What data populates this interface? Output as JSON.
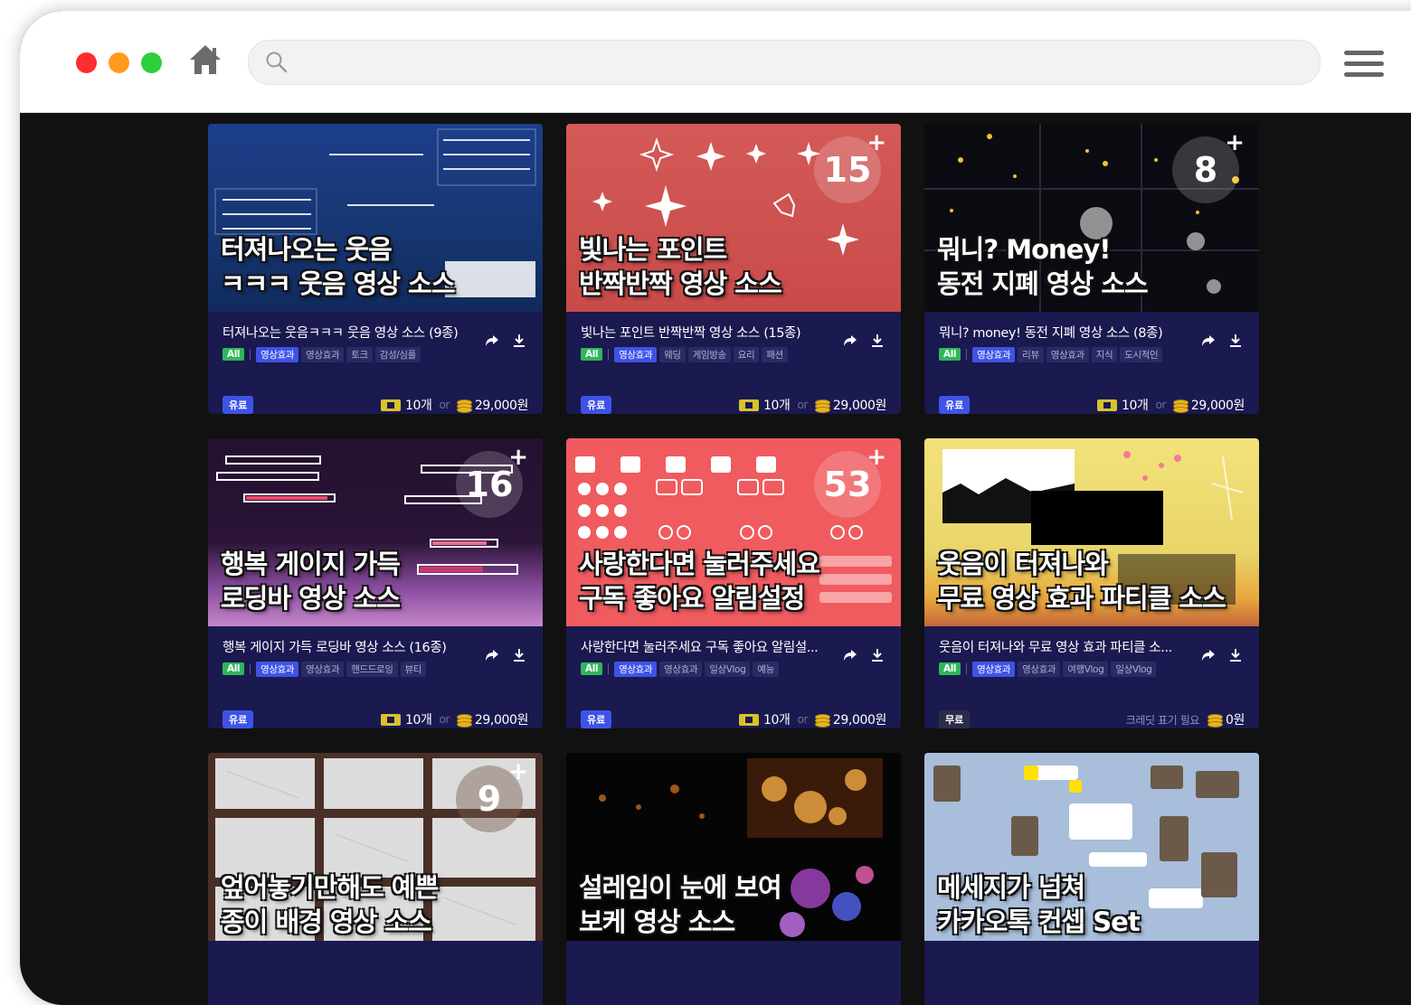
{
  "browser": {
    "search_placeholder": "",
    "icons": [
      "home-icon",
      "search-icon",
      "hamburger-menu-icon"
    ],
    "colors": {
      "close": "#ff2d2d",
      "minimize": "#ff9a1f",
      "maximize": "#2bd03a"
    }
  },
  "cards": [
    {
      "thumb_text": "터져나오는 웃음\nㅋㅋㅋ 웃음 영상 소스",
      "count": "",
      "title": "터져나오는 웃음ㅋㅋㅋ 웃음 영상 소스 (9종)",
      "tags": [
        "All",
        "영상효과",
        "영상효과",
        "토크",
        "감성/심플"
      ],
      "badge": "유료",
      "credit": "10개",
      "or": "or",
      "price": "29,000원",
      "note": ""
    },
    {
      "thumb_text": "빛나는 포인트\n반짝반짝 영상 소스",
      "count": "15",
      "title": "빛나는 포인트 반짝반짝 영상 소스 (15종)",
      "tags": [
        "All",
        "영상효과",
        "웨딩",
        "게임방송",
        "요리",
        "패션"
      ],
      "badge": "유료",
      "credit": "10개",
      "or": "or",
      "price": "29,000원",
      "note": ""
    },
    {
      "thumb_text": "뭐니? Money!\n동전 지폐 영상 소스",
      "count": "8",
      "title": "뭐니? money! 동전 지폐 영상 소스 (8종)",
      "tags": [
        "All",
        "영상효과",
        "리뷰",
        "영상효과",
        "지식",
        "도시적인"
      ],
      "badge": "유료",
      "credit": "10개",
      "or": "or",
      "price": "29,000원",
      "note": ""
    },
    {
      "thumb_text": "행복 게이지 가득\n로딩바 영상 소스",
      "count": "16",
      "title": "행복 게이지 가득 로딩바 영상 소스 (16종)",
      "tags": [
        "All",
        "영상효과",
        "영상효과",
        "핸드드로잉",
        "뷰티"
      ],
      "badge": "유료",
      "credit": "10개",
      "or": "or",
      "price": "29,000원",
      "note": ""
    },
    {
      "thumb_text": "사랑한다면 눌러주세요\n구독 좋아요 알림설정",
      "count": "53",
      "title": "사랑한다면 눌러주세요 구독 좋아요 알림설...",
      "tags": [
        "All",
        "영상효과",
        "영상효과",
        "일상Vlog",
        "예능"
      ],
      "badge": "유료",
      "credit": "10개",
      "or": "or",
      "price": "29,000원",
      "note": ""
    },
    {
      "thumb_text": "웃음이 터져나와\n무료 영상 효과 파티클 소스",
      "count": "",
      "title": "웃음이 터져나와 무료 영상 효과 파티클 소...",
      "tags": [
        "All",
        "영상효과",
        "영상효과",
        "여행Vlog",
        "일상Vlog"
      ],
      "badge": "무료",
      "credit": "",
      "or": "",
      "price": "0원",
      "note": "크레딧 표기 필요"
    },
    {
      "thumb_text": "엎어놓기만해도 예쁜\n종이 배경 영상 소스",
      "count": "9",
      "title": "",
      "tags": [],
      "badge": "",
      "credit": "",
      "or": "",
      "price": "",
      "note": ""
    },
    {
      "thumb_text": "설레임이 눈에 보여\n보케 영상 소스",
      "count": "",
      "title": "",
      "tags": [],
      "badge": "",
      "credit": "",
      "or": "",
      "price": "",
      "note": ""
    },
    {
      "thumb_text": "메세지가 넘쳐\n카카오톡 컨셉 Set",
      "count": "",
      "title": "",
      "tags": [],
      "badge": "",
      "credit": "",
      "or": "",
      "price": "",
      "note": ""
    }
  ]
}
